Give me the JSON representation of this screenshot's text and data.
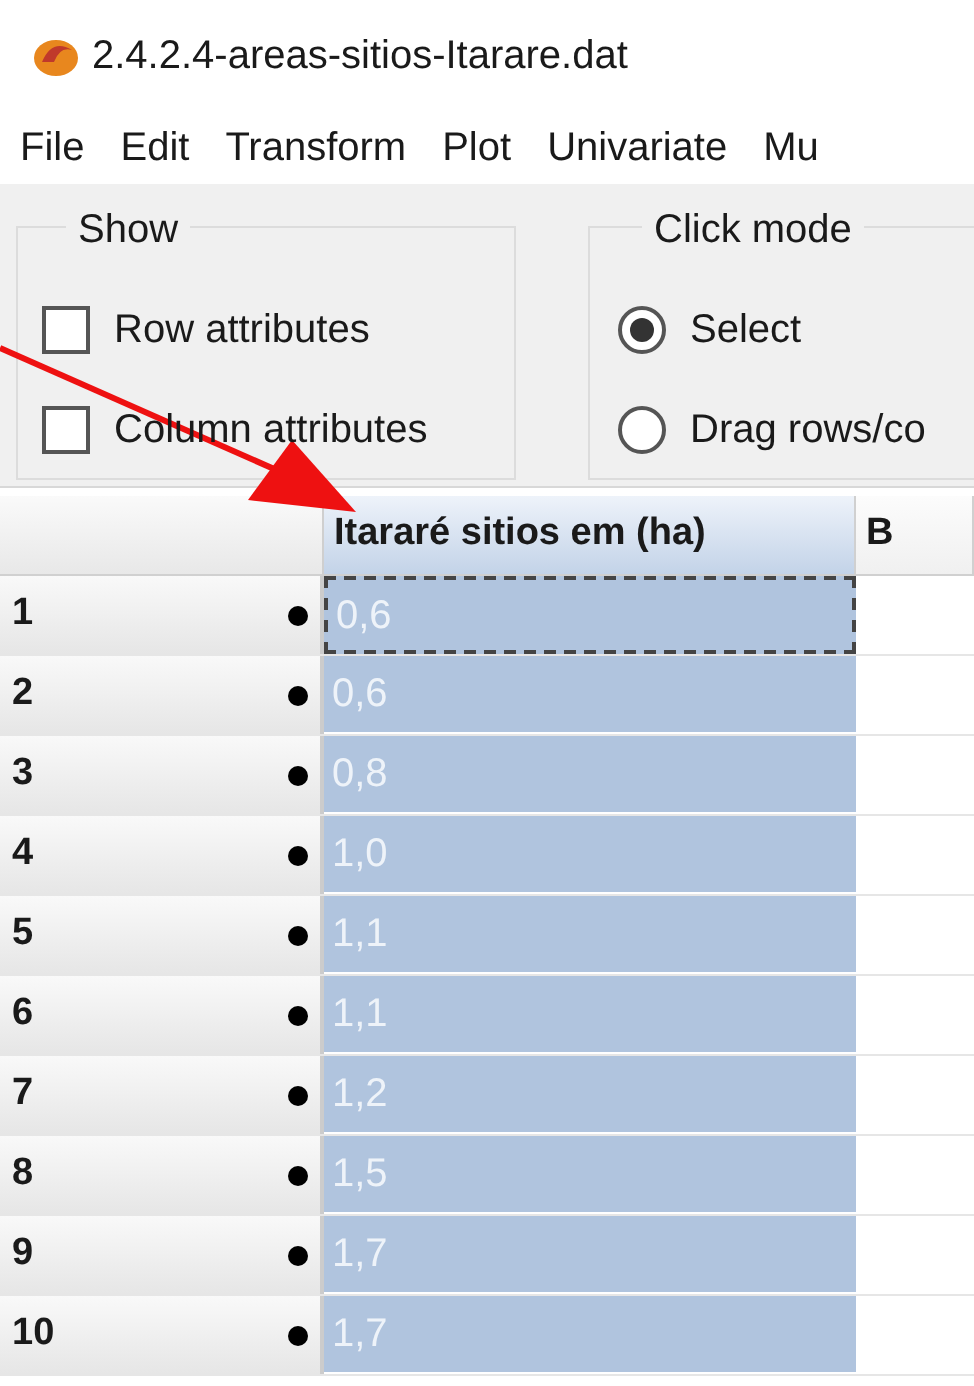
{
  "window": {
    "title": "2.4.2.4-areas-sitios-Itarare.dat"
  },
  "menu": [
    "File",
    "Edit",
    "Transform",
    "Plot",
    "Univariate",
    "Mu"
  ],
  "show_group": {
    "title": "Show",
    "options": [
      {
        "label": "Row attributes",
        "checked": false
      },
      {
        "label": "Column attributes",
        "checked": false
      }
    ]
  },
  "click_mode_group": {
    "title": "Click mode",
    "options": [
      {
        "label": "Select",
        "selected": true
      },
      {
        "label": "Drag rows/co",
        "selected": false
      }
    ]
  },
  "table": {
    "columns": [
      {
        "label": "Itararé sitios em (ha)",
        "selected": true
      },
      {
        "label": "B",
        "selected": false
      }
    ],
    "rows": [
      {
        "label": "1",
        "value": "0,6",
        "selected": true,
        "focused": true
      },
      {
        "label": "2",
        "value": "0,6",
        "selected": true,
        "focused": false
      },
      {
        "label": "3",
        "value": "0,8",
        "selected": true,
        "focused": false
      },
      {
        "label": "4",
        "value": "1,0",
        "selected": true,
        "focused": false
      },
      {
        "label": "5",
        "value": "1,1",
        "selected": true,
        "focused": false
      },
      {
        "label": "6",
        "value": "1,1",
        "selected": true,
        "focused": false
      },
      {
        "label": "7",
        "value": "1,2",
        "selected": true,
        "focused": false
      },
      {
        "label": "8",
        "value": "1,5",
        "selected": true,
        "focused": false
      },
      {
        "label": "9",
        "value": "1,7",
        "selected": true,
        "focused": false
      },
      {
        "label": "10",
        "value": "1,7",
        "selected": true,
        "focused": false
      }
    ]
  }
}
